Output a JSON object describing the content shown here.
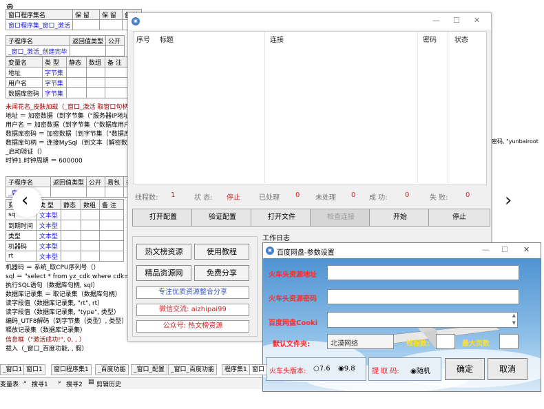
{
  "bg": {
    "table1_headers": [
      "窗口程序集名",
      "保 留",
      "保 留",
      "备 注"
    ],
    "table1_row": "窗口程序集_窗口_激活",
    "table2_headers": [
      "子程序名",
      "返回值类型",
      "公开"
    ],
    "table2_row": "_窗口_激活_创建完毕",
    "table3_headers": [
      "变量名",
      "类 型",
      "静态",
      "数组",
      "备 注"
    ],
    "table3_rows": [
      [
        "地址",
        "字节集"
      ],
      [
        "用户名",
        "字节集"
      ],
      [
        "数据库密码",
        "字节集"
      ]
    ],
    "code1": [
      "未闻花名_皮肤加载（_窗口_激活 取窗口句柄",
      "地址 ＝ 加密数据（到字节集（\"服务器IP地址",
      "用户名 ＝ 加密数据（到字节集（\"数据库用户",
      "数据库密码 ＝ 加密数据（到字节集（\"数据库",
      "数据库句柄 ＝ 连接MySql（到文本（解密数据",
      "_启动验证（）",
      "时钟1.时钟周期 ＝ 600000"
    ],
    "right_overflow": "密码, \"yunbairoot",
    "table4_headers": [
      "子程序名",
      "返回值类型",
      "公开",
      "易包",
      "备"
    ],
    "table4_row": "_启动验证",
    "table5_headers": [
      "变",
      "类 型",
      "静态",
      "数组",
      "备 注"
    ],
    "table5_rows": [
      [
        "sq",
        "文本型"
      ],
      [
        "到期时间",
        "文本型"
      ],
      [
        "类型",
        "文本型"
      ],
      [
        "机器码",
        "文本型"
      ],
      [
        "rt",
        "文本型"
      ]
    ],
    "code2": [
      "机器码 ＝ 系统_取CPU序列号（）",
      "sql ＝ \"select * from yz_cdk where cdk='",
      "执行SQL语句（数据库句柄, sql）",
      "数据库记录集 ＝ 取记录集（数据库句柄）",
      "读字段值（数据库记录集, \"rt\", rt）",
      "读字段值（数据库记录集, \"type\", 类型）",
      "编码_UTF8解码（到字节集（类型）, 类型）",
      "释放记录集（数据库记录集）",
      "信息框（\"激活成功!\", 0, , ）",
      "载入（_窗口_百度功能, , 假）"
    ]
  },
  "main": {
    "columns": [
      "序号",
      "标题",
      "连接",
      "密码",
      "状态"
    ],
    "stats": [
      {
        "label": "线程数:",
        "value": "1"
      },
      {
        "label": "状 态:",
        "value": "停止"
      },
      {
        "label": "已处理",
        "value": "0"
      },
      {
        "label": "未处理",
        "value": "0"
      },
      {
        "label": "成 功:",
        "value": "0"
      },
      {
        "label": "失 败:",
        "value": "0"
      }
    ],
    "buttons": [
      "打开配置",
      "验证配置",
      "打开文件",
      "检查连接",
      "开始",
      "停止"
    ],
    "log_label": "工作日志",
    "res_buttons": [
      "热文榜资源",
      "使用教程",
      "精品资源网",
      "免费分享"
    ],
    "promo": [
      "专注优质资源整合分享",
      "微信交流: aizhipai99",
      "公众号: 热文榜资源"
    ]
  },
  "dialog": {
    "title": "百度网盘-参数设置",
    "fields": [
      "火车头资源地址",
      "火车头资源密码",
      "百度网盘Cooki"
    ],
    "default_folder_label": "默认文件夹:",
    "default_folder_value": "北漠网络",
    "threads_label": "线程数:",
    "max_pages_label": "最大页数",
    "version_label": "火车头版本:",
    "version_options": [
      "7.6",
      "9.8"
    ],
    "code_label": "提 取 码:",
    "code_option": "随机",
    "ok": "确定",
    "cancel": "取消"
  },
  "tabs": [
    "_窗口1",
    "窗口1",
    "窗口程序集1",
    "_百度功能",
    "_窗口_配置",
    "_窗口_百度功能",
    "程序集1",
    "窗口"
  ],
  "bottom": [
    "变量表",
    "搜寻1",
    "搜寻2",
    "剪辑历史"
  ]
}
